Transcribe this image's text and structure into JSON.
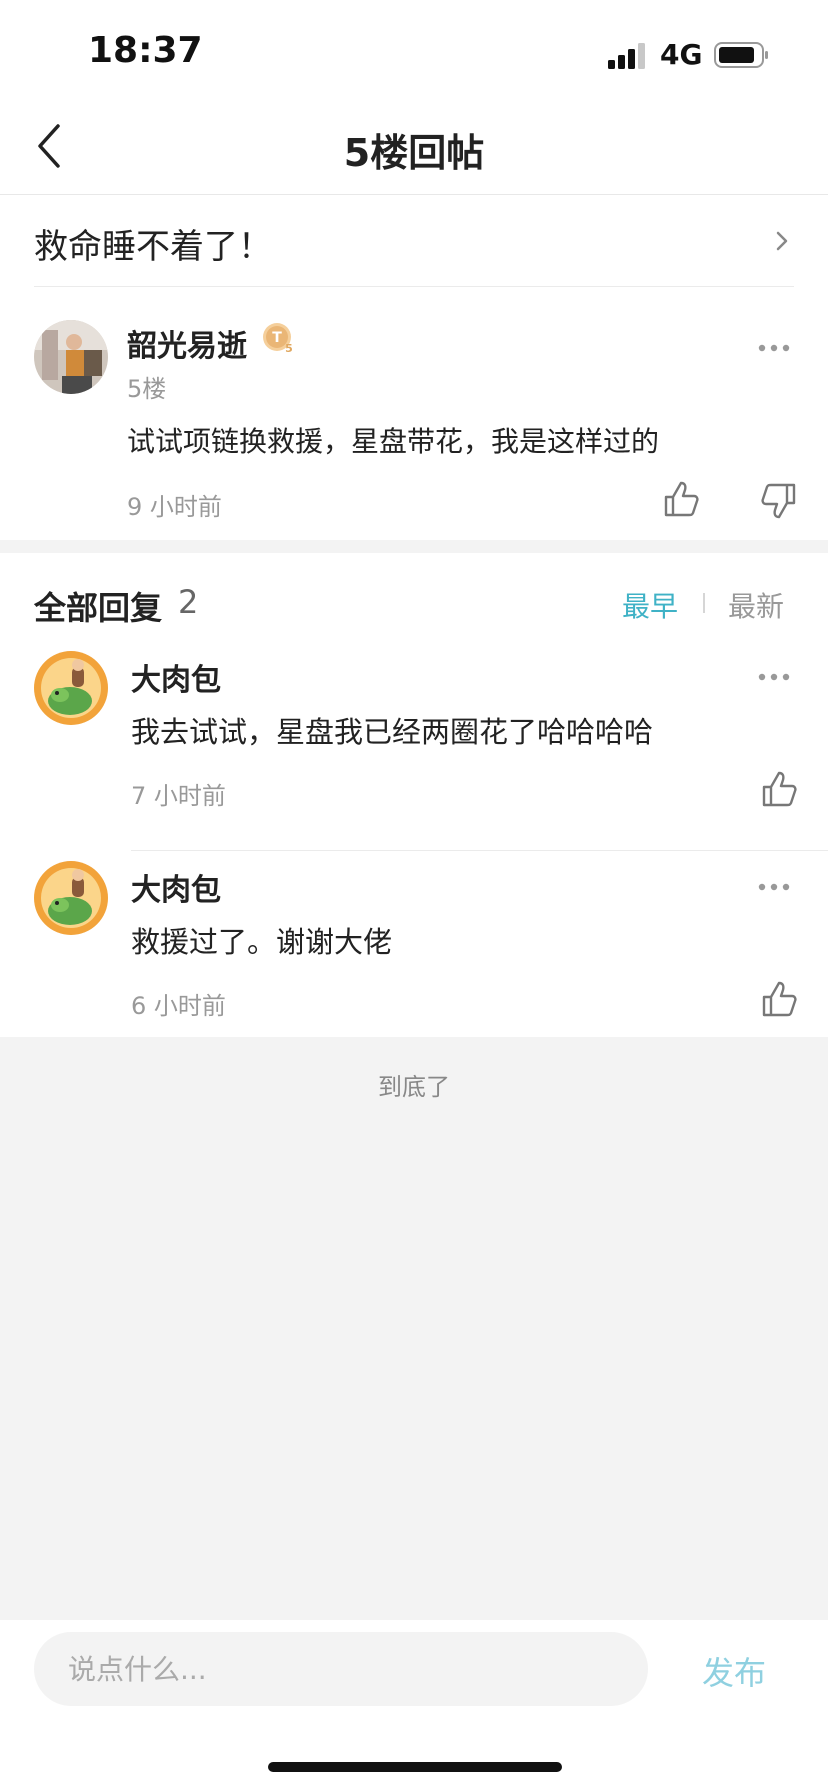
{
  "status_bar": {
    "time": "18:37",
    "network": "4G"
  },
  "nav": {
    "title": "5楼回帖"
  },
  "thread": {
    "title": "救命睡不着了！"
  },
  "post": {
    "author": "韶光易逝",
    "badge": "T5",
    "floor": "5楼",
    "content": "试试项链换救援，星盘带花，我是这样过的",
    "time": "9 小时前"
  },
  "replies": {
    "header": "全部回复",
    "count": "2",
    "sort_earliest": "最早",
    "sort_latest": "最新",
    "items": [
      {
        "author": "大肉包",
        "content": "我去试试，星盘我已经两圈花了哈哈哈哈",
        "time": "7 小时前"
      },
      {
        "author": "大肉包",
        "content": "救援过了。谢谢大佬",
        "time": "6 小时前"
      }
    ]
  },
  "end_text": "到底了",
  "bottom_bar": {
    "input_placeholder": "说点什么...",
    "publish_label": "发布"
  },
  "colors": {
    "accent": "#3fb2c6",
    "publish": "#8fd0e0",
    "background": "#f3f3f3"
  }
}
